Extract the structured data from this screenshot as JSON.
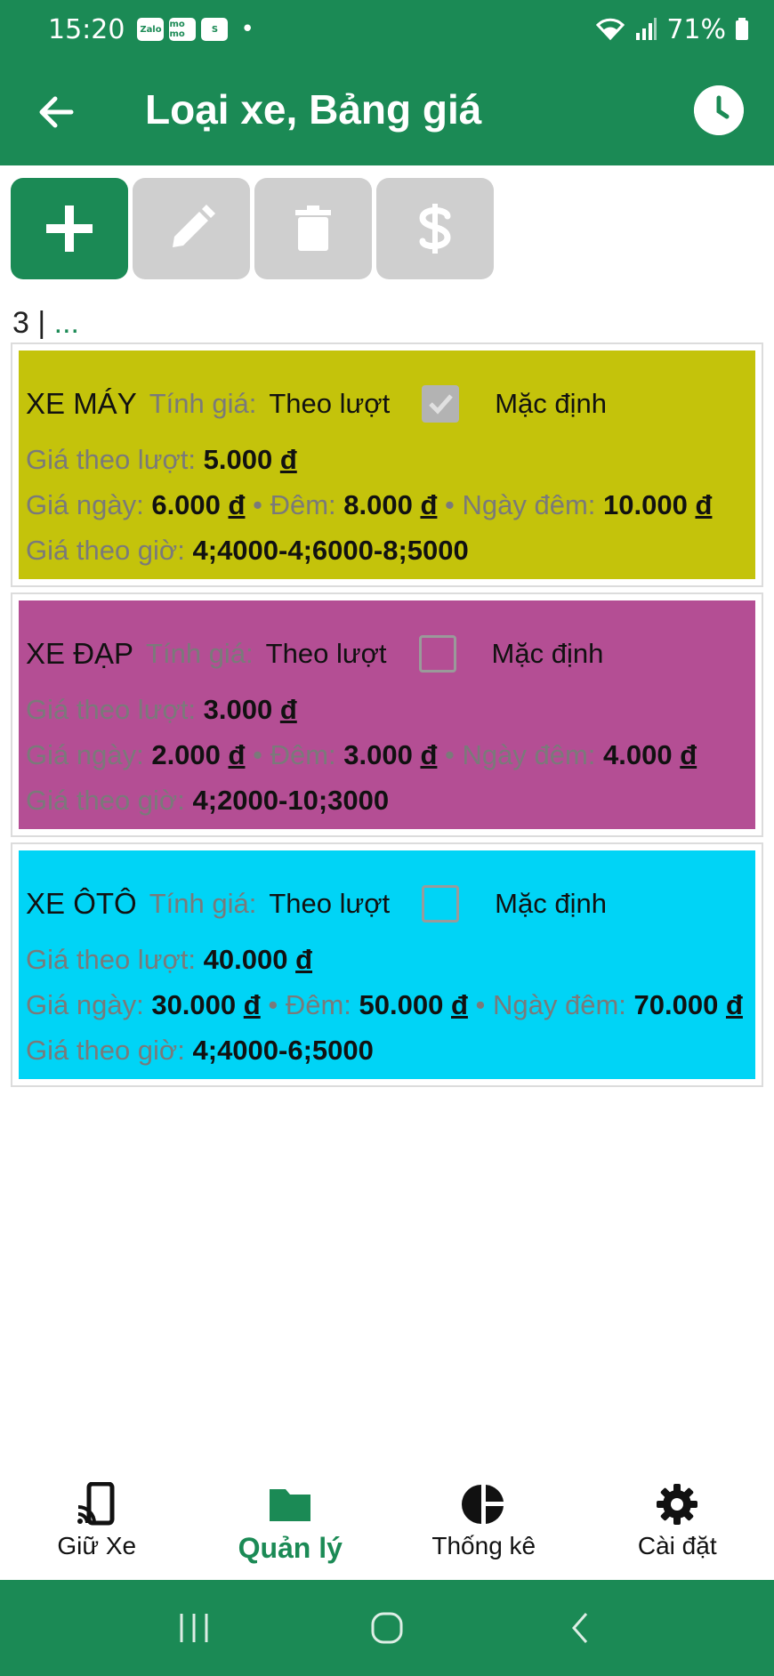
{
  "status_bar": {
    "time": "15:20",
    "apps": [
      "Zalo",
      "mo mo",
      "S"
    ],
    "battery": "71%"
  },
  "app_bar": {
    "title": "Loại xe, Bảng giá"
  },
  "toolbar": {
    "buttons": [
      "add-icon",
      "edit-icon",
      "delete-icon",
      "dollar-icon"
    ]
  },
  "list_header": {
    "count": "3 | ",
    "ellipsis": "..."
  },
  "labels": {
    "pricing": "Tính giá:",
    "default": "Mặc định",
    "per_turn": "Giá theo lượt:",
    "day": "Giá ngày:",
    "night": "Đêm:",
    "day_night": "Ngày đêm:",
    "hourly": "Giá theo giờ:",
    "bullet": " • "
  },
  "vehicles": [
    {
      "name": "XE MÁY",
      "mode": "Theo lượt",
      "is_default": true,
      "bg": "#c4c30b",
      "per_turn": "5.000",
      "day": "6.000",
      "night": "8.000",
      "day_night": "10.000",
      "currency": "đ",
      "hourly": "4;4000-4;6000-8;5000"
    },
    {
      "name": "XE ĐẠP",
      "mode": "Theo lượt",
      "is_default": false,
      "bg": "#b44e94",
      "per_turn": "3.000",
      "day": "2.000",
      "night": "3.000",
      "day_night": "4.000",
      "currency": "đ",
      "hourly": "4;2000-10;3000"
    },
    {
      "name": "XE ÔTÔ",
      "mode": "Theo lượt",
      "is_default": false,
      "bg": "#00d4f6",
      "per_turn": "40.000",
      "day": "30.000",
      "night": "50.000",
      "day_night": "70.000",
      "currency": "đ",
      "hourly": "4;4000-6;5000"
    }
  ],
  "bottom_nav": [
    {
      "label": "Giữ Xe",
      "icon": "phone-cast-icon",
      "active": false
    },
    {
      "label": "Quản lý",
      "icon": "folder-icon",
      "active": true
    },
    {
      "label": "Thống kê",
      "icon": "pie-chart-icon",
      "active": false
    },
    {
      "label": "Cài đặt",
      "icon": "gear-icon",
      "active": false
    }
  ],
  "colors": {
    "primary": "#1b8a55",
    "disabled": "#cfcfcf"
  }
}
